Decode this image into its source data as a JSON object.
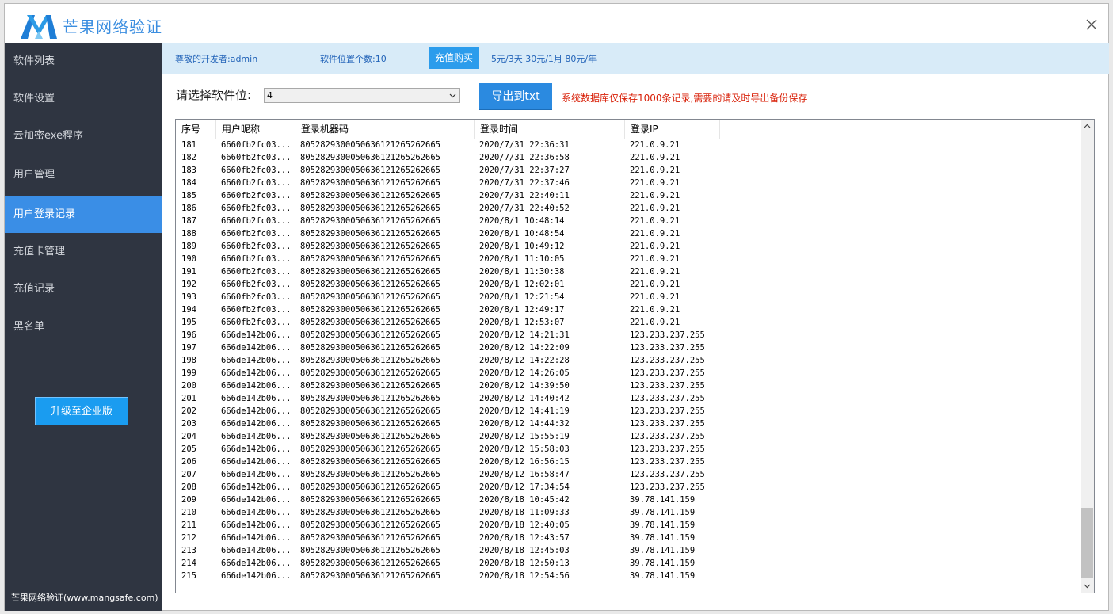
{
  "app": {
    "title": "芒果网络验证",
    "footer": "芒果网络验证(www.mangsafe.com)"
  },
  "sidebar": {
    "items": [
      {
        "label": "软件列表"
      },
      {
        "label": "软件设置"
      },
      {
        "label": "云加密exe程序"
      },
      {
        "label": "用户管理"
      },
      {
        "label": "用户登录记录"
      },
      {
        "label": "充值卡管理"
      },
      {
        "label": "充值记录"
      },
      {
        "label": "黑名单"
      }
    ],
    "active_index": 4,
    "upgrade_label": "升级至企业版"
  },
  "infobar": {
    "developer": "尊敬的开发者:admin",
    "slot_count": "软件位置个数:10",
    "buy_label": "充值购买",
    "prices": "5元/3天 30元/1月 80元/年"
  },
  "toolbar": {
    "select_label": "请选择软件位:",
    "select_value": "4",
    "export_label": "导出到txt",
    "note": "系统数据库仅保存1000条记录,需要的请及时导出备份保存"
  },
  "table": {
    "columns": [
      "序号",
      "用户昵称",
      "登录机器码",
      "登录时间",
      "登录IP"
    ],
    "rows": [
      [
        "181",
        "6660fb2fc03...",
        "8052829300050636121265262665",
        "2020/7/31 22:36:31",
        "221.0.9.21"
      ],
      [
        "182",
        "6660fb2fc03...",
        "8052829300050636121265262665",
        "2020/7/31 22:36:58",
        "221.0.9.21"
      ],
      [
        "183",
        "6660fb2fc03...",
        "8052829300050636121265262665",
        "2020/7/31 22:37:27",
        "221.0.9.21"
      ],
      [
        "184",
        "6660fb2fc03...",
        "8052829300050636121265262665",
        "2020/7/31 22:37:46",
        "221.0.9.21"
      ],
      [
        "185",
        "6660fb2fc03...",
        "8052829300050636121265262665",
        "2020/7/31 22:40:11",
        "221.0.9.21"
      ],
      [
        "186",
        "6660fb2fc03...",
        "8052829300050636121265262665",
        "2020/7/31 22:40:52",
        "221.0.9.21"
      ],
      [
        "187",
        "6660fb2fc03...",
        "8052829300050636121265262665",
        "2020/8/1 10:48:14",
        "221.0.9.21"
      ],
      [
        "188",
        "6660fb2fc03...",
        "8052829300050636121265262665",
        "2020/8/1 10:48:54",
        "221.0.9.21"
      ],
      [
        "189",
        "6660fb2fc03...",
        "8052829300050636121265262665",
        "2020/8/1 10:49:12",
        "221.0.9.21"
      ],
      [
        "190",
        "6660fb2fc03...",
        "8052829300050636121265262665",
        "2020/8/1 11:10:05",
        "221.0.9.21"
      ],
      [
        "191",
        "6660fb2fc03...",
        "8052829300050636121265262665",
        "2020/8/1 11:30:38",
        "221.0.9.21"
      ],
      [
        "192",
        "6660fb2fc03...",
        "8052829300050636121265262665",
        "2020/8/1 12:02:01",
        "221.0.9.21"
      ],
      [
        "193",
        "6660fb2fc03...",
        "8052829300050636121265262665",
        "2020/8/1 12:21:54",
        "221.0.9.21"
      ],
      [
        "194",
        "6660fb2fc03...",
        "8052829300050636121265262665",
        "2020/8/1 12:49:17",
        "221.0.9.21"
      ],
      [
        "195",
        "6660fb2fc03...",
        "8052829300050636121265262665",
        "2020/8/1 12:53:07",
        "221.0.9.21"
      ],
      [
        "196",
        "666de142b06...",
        "8052829300050636121265262665",
        "2020/8/12 14:21:31",
        "123.233.237.255"
      ],
      [
        "197",
        "666de142b06...",
        "8052829300050636121265262665",
        "2020/8/12 14:22:09",
        "123.233.237.255"
      ],
      [
        "198",
        "666de142b06...",
        "8052829300050636121265262665",
        "2020/8/12 14:22:28",
        "123.233.237.255"
      ],
      [
        "199",
        "666de142b06...",
        "8052829300050636121265262665",
        "2020/8/12 14:26:05",
        "123.233.237.255"
      ],
      [
        "200",
        "666de142b06...",
        "8052829300050636121265262665",
        "2020/8/12 14:39:50",
        "123.233.237.255"
      ],
      [
        "201",
        "666de142b06...",
        "8052829300050636121265262665",
        "2020/8/12 14:40:42",
        "123.233.237.255"
      ],
      [
        "202",
        "666de142b06...",
        "8052829300050636121265262665",
        "2020/8/12 14:41:19",
        "123.233.237.255"
      ],
      [
        "203",
        "666de142b06...",
        "8052829300050636121265262665",
        "2020/8/12 14:44:32",
        "123.233.237.255"
      ],
      [
        "204",
        "666de142b06...",
        "8052829300050636121265262665",
        "2020/8/12 15:55:19",
        "123.233.237.255"
      ],
      [
        "205",
        "666de142b06...",
        "8052829300050636121265262665",
        "2020/8/12 15:58:03",
        "123.233.237.255"
      ],
      [
        "206",
        "666de142b06...",
        "8052829300050636121265262665",
        "2020/8/12 16:56:15",
        "123.233.237.255"
      ],
      [
        "207",
        "666de142b06...",
        "8052829300050636121265262665",
        "2020/8/12 16:58:47",
        "123.233.237.255"
      ],
      [
        "208",
        "666de142b06...",
        "8052829300050636121265262665",
        "2020/8/12 17:34:54",
        "123.233.237.255"
      ],
      [
        "209",
        "666de142b06...",
        "8052829300050636121265262665",
        "2020/8/18 10:45:42",
        "39.78.141.159"
      ],
      [
        "210",
        "666de142b06...",
        "8052829300050636121265262665",
        "2020/8/18 11:09:33",
        "39.78.141.159"
      ],
      [
        "211",
        "666de142b06...",
        "8052829300050636121265262665",
        "2020/8/18 12:40:05",
        "39.78.141.159"
      ],
      [
        "212",
        "666de142b06...",
        "8052829300050636121265262665",
        "2020/8/18 12:43:57",
        "39.78.141.159"
      ],
      [
        "213",
        "666de142b06...",
        "8052829300050636121265262665",
        "2020/8/18 12:45:03",
        "39.78.141.159"
      ],
      [
        "214",
        "666de142b06...",
        "8052829300050636121265262665",
        "2020/8/18 12:50:13",
        "39.78.141.159"
      ],
      [
        "215",
        "666de142b06...",
        "8052829300050636121265262665",
        "2020/8/18 12:54:56",
        "39.78.141.159"
      ]
    ]
  },
  "colors": {
    "accent": "#3a8ee6",
    "sidebar_bg": "#2f3541",
    "infobar_bg": "#d8ebf8",
    "note_red": "#d81e06"
  },
  "icons": {
    "logo": "mango-logo-icon",
    "close": "close-icon",
    "dropdown": "chevron-down-icon",
    "scroll_up": "chevron-up-icon",
    "scroll_down": "chevron-down-icon"
  }
}
